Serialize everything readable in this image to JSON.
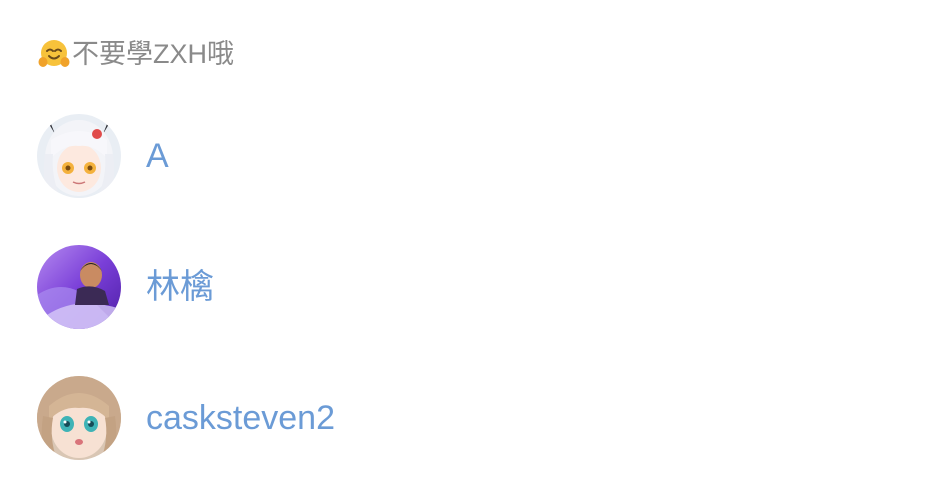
{
  "header": {
    "emoji_icon": "hugging-face-icon",
    "title": "不要學ZXH哦"
  },
  "users": [
    {
      "name": "A",
      "avatar_icon": "anime-girl-white-hair-avatar"
    },
    {
      "name": "林檎",
      "avatar_icon": "man-portrait-purple-avatar"
    },
    {
      "name": "casksteven2",
      "avatar_icon": "anime-girl-blonde-avatar"
    }
  ],
  "colors": {
    "link": "#6b9bd6",
    "header_text": "#8a8a8a",
    "background": "#ffffff"
  }
}
